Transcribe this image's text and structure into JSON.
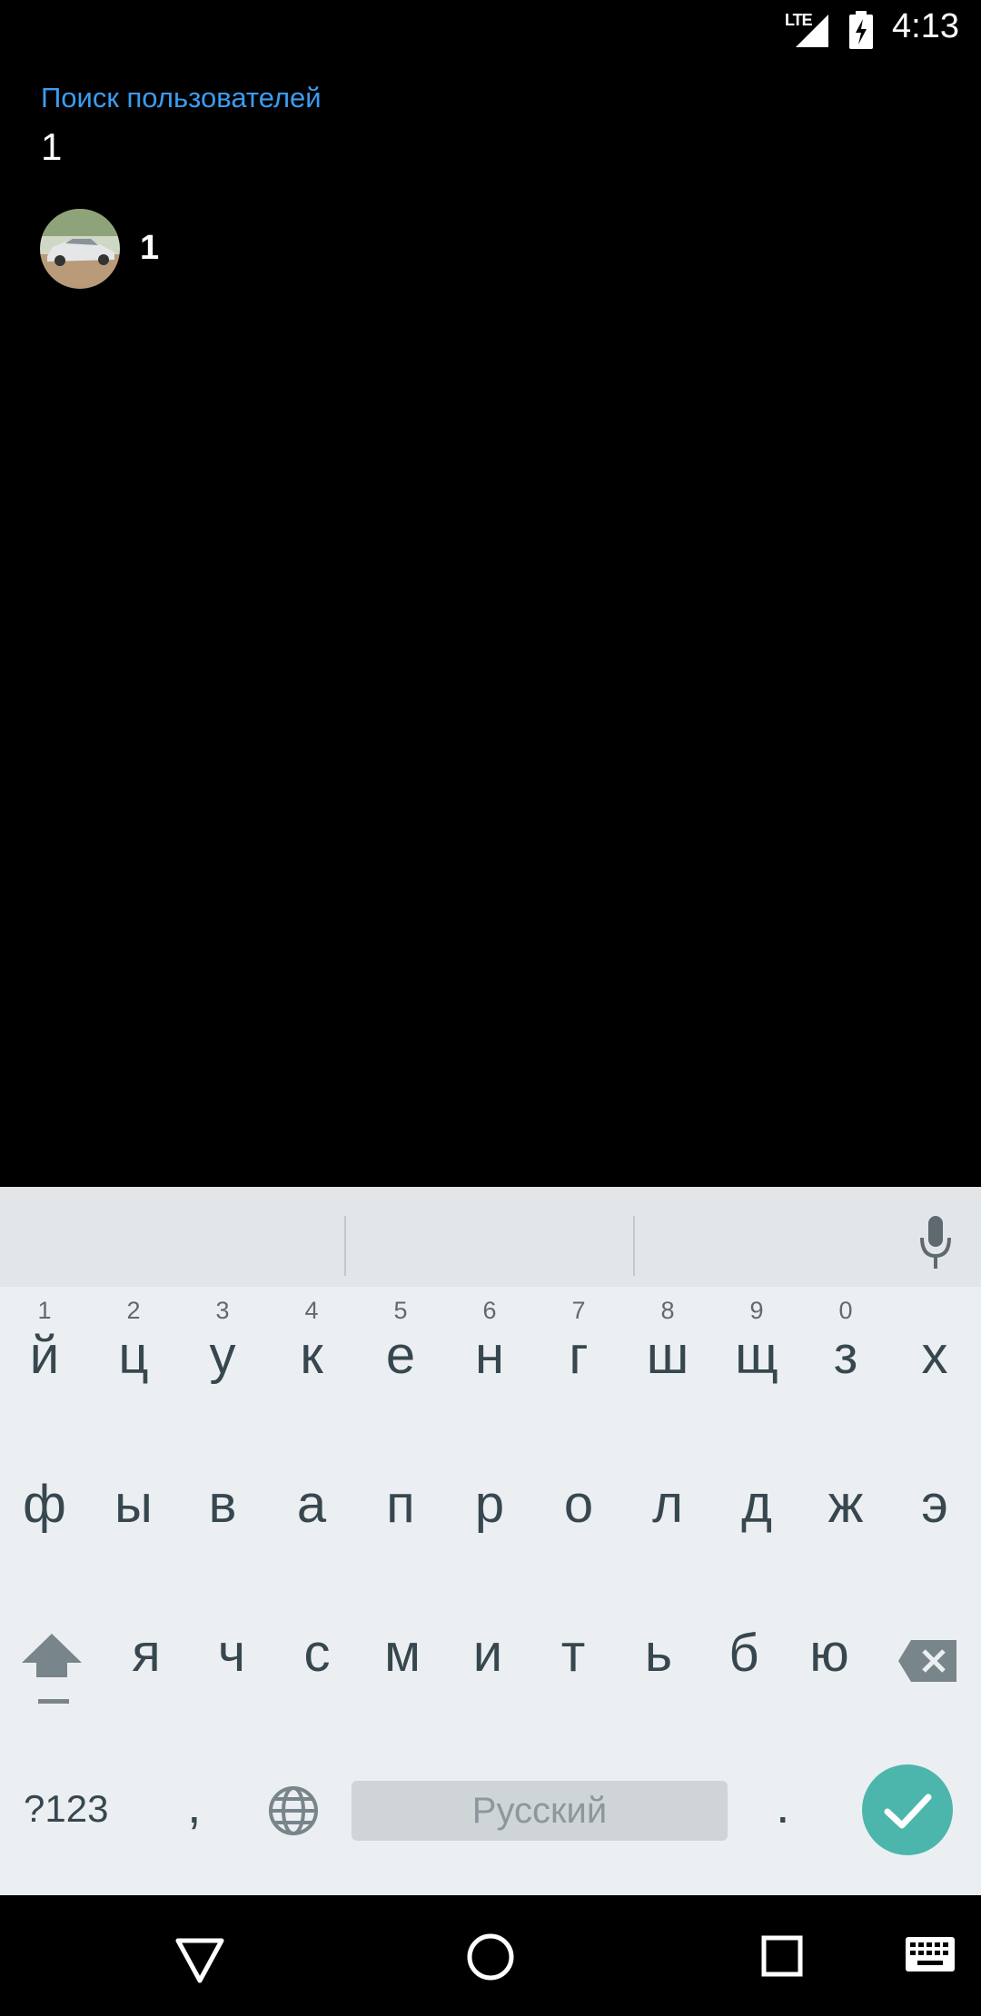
{
  "status_bar": {
    "network": "LTE",
    "time": "4:13"
  },
  "search": {
    "label": "Поиск пользователей",
    "value": "1"
  },
  "results": [
    {
      "name": "1"
    }
  ],
  "keyboard": {
    "row1": [
      {
        "letter": "й",
        "hint": "1"
      },
      {
        "letter": "ц",
        "hint": "2"
      },
      {
        "letter": "у",
        "hint": "3"
      },
      {
        "letter": "к",
        "hint": "4"
      },
      {
        "letter": "е",
        "hint": "5"
      },
      {
        "letter": "н",
        "hint": "6"
      },
      {
        "letter": "г",
        "hint": "7"
      },
      {
        "letter": "ш",
        "hint": "8"
      },
      {
        "letter": "щ",
        "hint": "9"
      },
      {
        "letter": "з",
        "hint": "0"
      },
      {
        "letter": "х",
        "hint": ""
      }
    ],
    "row2": [
      "ф",
      "ы",
      "в",
      "а",
      "п",
      "р",
      "о",
      "л",
      "д",
      "ж",
      "э"
    ],
    "row3": [
      "я",
      "ч",
      "с",
      "м",
      "и",
      "т",
      "ь",
      "б",
      "ю"
    ],
    "symbols_label": "?123",
    "comma": ",",
    "period": ".",
    "space_label": "Русский",
    "colors": {
      "background": "#eceff1",
      "text": "#37474f",
      "enter": "#4db6ac"
    }
  },
  "colors": {
    "label_accent": "#3b9cf0",
    "background": "#000000"
  }
}
